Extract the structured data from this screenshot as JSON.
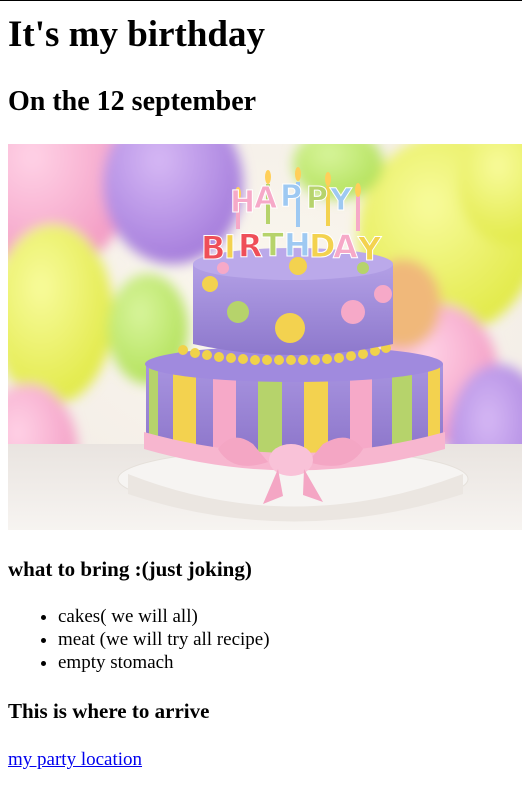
{
  "page": {
    "title": "It's my birthday",
    "date_heading": "On the 12 september"
  },
  "hero_image": {
    "cake_topper_text": "HAPPY BIRTHDAY",
    "colors": {
      "cake_purple": "#9b86d6",
      "stripe_yellow": "#f3d24f",
      "stripe_green": "#b6d36b",
      "stripe_pink": "#f6a9c8",
      "ribbon_pink": "#f7b6cf",
      "balloon_yellow": "#eef26a",
      "balloon_purple": "#b78ee6"
    }
  },
  "bring": {
    "heading": "what to bring :(just joking)",
    "items": [
      "cakes( we will all)",
      "meat (we will try all recipe)",
      "empty stomach"
    ]
  },
  "arrive": {
    "heading": "This is where to arrive",
    "link_text": "my party location"
  }
}
